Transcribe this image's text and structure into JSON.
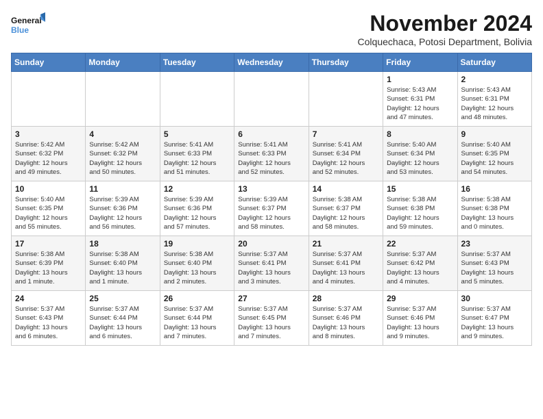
{
  "logo": {
    "text_general": "General",
    "text_blue": "Blue"
  },
  "header": {
    "month": "November 2024",
    "location": "Colquechaca, Potosi Department, Bolivia"
  },
  "weekdays": [
    "Sunday",
    "Monday",
    "Tuesday",
    "Wednesday",
    "Thursday",
    "Friday",
    "Saturday"
  ],
  "weeks": [
    [
      {
        "day": "",
        "info": ""
      },
      {
        "day": "",
        "info": ""
      },
      {
        "day": "",
        "info": ""
      },
      {
        "day": "",
        "info": ""
      },
      {
        "day": "",
        "info": ""
      },
      {
        "day": "1",
        "info": "Sunrise: 5:43 AM\nSunset: 6:31 PM\nDaylight: 12 hours\nand 47 minutes."
      },
      {
        "day": "2",
        "info": "Sunrise: 5:43 AM\nSunset: 6:31 PM\nDaylight: 12 hours\nand 48 minutes."
      }
    ],
    [
      {
        "day": "3",
        "info": "Sunrise: 5:42 AM\nSunset: 6:32 PM\nDaylight: 12 hours\nand 49 minutes."
      },
      {
        "day": "4",
        "info": "Sunrise: 5:42 AM\nSunset: 6:32 PM\nDaylight: 12 hours\nand 50 minutes."
      },
      {
        "day": "5",
        "info": "Sunrise: 5:41 AM\nSunset: 6:33 PM\nDaylight: 12 hours\nand 51 minutes."
      },
      {
        "day": "6",
        "info": "Sunrise: 5:41 AM\nSunset: 6:33 PM\nDaylight: 12 hours\nand 52 minutes."
      },
      {
        "day": "7",
        "info": "Sunrise: 5:41 AM\nSunset: 6:34 PM\nDaylight: 12 hours\nand 52 minutes."
      },
      {
        "day": "8",
        "info": "Sunrise: 5:40 AM\nSunset: 6:34 PM\nDaylight: 12 hours\nand 53 minutes."
      },
      {
        "day": "9",
        "info": "Sunrise: 5:40 AM\nSunset: 6:35 PM\nDaylight: 12 hours\nand 54 minutes."
      }
    ],
    [
      {
        "day": "10",
        "info": "Sunrise: 5:40 AM\nSunset: 6:35 PM\nDaylight: 12 hours\nand 55 minutes."
      },
      {
        "day": "11",
        "info": "Sunrise: 5:39 AM\nSunset: 6:36 PM\nDaylight: 12 hours\nand 56 minutes."
      },
      {
        "day": "12",
        "info": "Sunrise: 5:39 AM\nSunset: 6:36 PM\nDaylight: 12 hours\nand 57 minutes."
      },
      {
        "day": "13",
        "info": "Sunrise: 5:39 AM\nSunset: 6:37 PM\nDaylight: 12 hours\nand 58 minutes."
      },
      {
        "day": "14",
        "info": "Sunrise: 5:38 AM\nSunset: 6:37 PM\nDaylight: 12 hours\nand 58 minutes."
      },
      {
        "day": "15",
        "info": "Sunrise: 5:38 AM\nSunset: 6:38 PM\nDaylight: 12 hours\nand 59 minutes."
      },
      {
        "day": "16",
        "info": "Sunrise: 5:38 AM\nSunset: 6:38 PM\nDaylight: 13 hours\nand 0 minutes."
      }
    ],
    [
      {
        "day": "17",
        "info": "Sunrise: 5:38 AM\nSunset: 6:39 PM\nDaylight: 13 hours\nand 1 minute."
      },
      {
        "day": "18",
        "info": "Sunrise: 5:38 AM\nSunset: 6:40 PM\nDaylight: 13 hours\nand 1 minute."
      },
      {
        "day": "19",
        "info": "Sunrise: 5:38 AM\nSunset: 6:40 PM\nDaylight: 13 hours\nand 2 minutes."
      },
      {
        "day": "20",
        "info": "Sunrise: 5:37 AM\nSunset: 6:41 PM\nDaylight: 13 hours\nand 3 minutes."
      },
      {
        "day": "21",
        "info": "Sunrise: 5:37 AM\nSunset: 6:41 PM\nDaylight: 13 hours\nand 4 minutes."
      },
      {
        "day": "22",
        "info": "Sunrise: 5:37 AM\nSunset: 6:42 PM\nDaylight: 13 hours\nand 4 minutes."
      },
      {
        "day": "23",
        "info": "Sunrise: 5:37 AM\nSunset: 6:43 PM\nDaylight: 13 hours\nand 5 minutes."
      }
    ],
    [
      {
        "day": "24",
        "info": "Sunrise: 5:37 AM\nSunset: 6:43 PM\nDaylight: 13 hours\nand 6 minutes."
      },
      {
        "day": "25",
        "info": "Sunrise: 5:37 AM\nSunset: 6:44 PM\nDaylight: 13 hours\nand 6 minutes."
      },
      {
        "day": "26",
        "info": "Sunrise: 5:37 AM\nSunset: 6:44 PM\nDaylight: 13 hours\nand 7 minutes."
      },
      {
        "day": "27",
        "info": "Sunrise: 5:37 AM\nSunset: 6:45 PM\nDaylight: 13 hours\nand 7 minutes."
      },
      {
        "day": "28",
        "info": "Sunrise: 5:37 AM\nSunset: 6:46 PM\nDaylight: 13 hours\nand 8 minutes."
      },
      {
        "day": "29",
        "info": "Sunrise: 5:37 AM\nSunset: 6:46 PM\nDaylight: 13 hours\nand 9 minutes."
      },
      {
        "day": "30",
        "info": "Sunrise: 5:37 AM\nSunset: 6:47 PM\nDaylight: 13 hours\nand 9 minutes."
      }
    ]
  ]
}
